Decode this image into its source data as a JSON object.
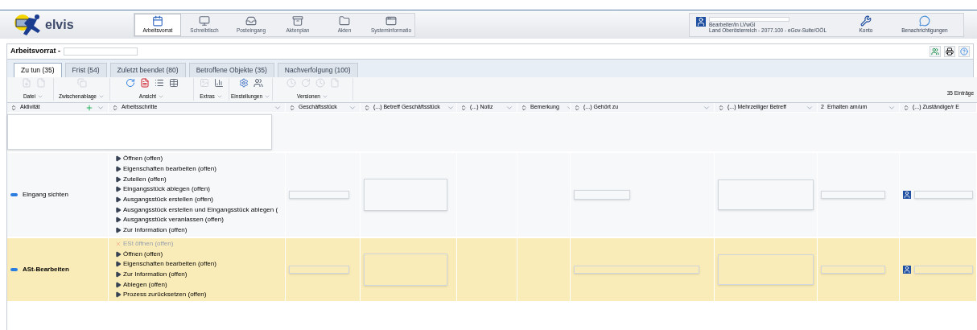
{
  "header": {
    "logo": "elvis",
    "nav": [
      {
        "label": "Arbeitsvorrat",
        "selected": true
      },
      {
        "label": "Schreibtisch",
        "selected": false
      },
      {
        "label": "Posteingang",
        "selected": false
      },
      {
        "label": "Aktenplan",
        "selected": false
      },
      {
        "label": "Akten",
        "selected": false
      },
      {
        "label": "Systeminformatio",
        "selected": false
      }
    ],
    "user": {
      "role": "Bearbeiter/in LVwGl",
      "org": "Land Oberösterreich - 2077.100 - eGov-Suite/OÖL"
    },
    "user_buttons": [
      "Konto",
      "Benachrichtigungen"
    ]
  },
  "breadcrumb": "Arbeitsvorrat -",
  "tabs": [
    {
      "label": "Zu tun (35)",
      "selected": true
    },
    {
      "label": "Frist (54)",
      "selected": false
    },
    {
      "label": "Zuletzt beendet (80)",
      "selected": false
    },
    {
      "label": "Betroffene Objekte (35)",
      "selected": false
    },
    {
      "label": "Nachverfolgung (100)",
      "selected": false
    }
  ],
  "toolbar": {
    "groups": [
      "Datei",
      "Zwischenablage",
      "Ansicht",
      "Extras",
      "Einstellungen",
      "Versionen"
    ],
    "count": "35 Einträge"
  },
  "table": {
    "columns": [
      {
        "label": "Aktivität"
      },
      {
        "label": "Arbeitsschritte"
      },
      {
        "label": "Geschäftsstück"
      },
      {
        "label": "(...) Betreff Geschäftsstück"
      },
      {
        "label": "(...) Notiz"
      },
      {
        "label": "Bemerkung"
      },
      {
        "label": "(...) Gehört zu"
      },
      {
        "label": "(...) Mehrzeiliger Betreff"
      },
      {
        "label": "Erhalten am/um",
        "sort_index": "2"
      },
      {
        "label": "(...) Zuständige/r E"
      }
    ],
    "rows": [
      {
        "activity": "Eingang sichten",
        "selected": false,
        "steps": [
          {
            "label": "Öffnen (offen)",
            "disabled": false
          },
          {
            "label": "Eigenschaften bearbeiten (offen)",
            "disabled": false
          },
          {
            "label": "Zuteilen (offen)",
            "disabled": false
          },
          {
            "label": "Eingangsstück ablegen (offen)",
            "disabled": false
          },
          {
            "label": "Ausgangsstück erstellen (offen)",
            "disabled": false
          },
          {
            "label": "Ausgangsstück erstellen und Eingangsstück ablegen (",
            "disabled": false
          },
          {
            "label": "Ausgangsstück veranlassen (offen)",
            "disabled": false
          },
          {
            "label": "Zur Information (offen)",
            "disabled": false
          }
        ]
      },
      {
        "activity": "ASt-Bearbeiten",
        "selected": true,
        "steps": [
          {
            "label": "ESt öffnen (offen)",
            "disabled": true
          },
          {
            "label": "Öffnen (offen)",
            "disabled": false
          },
          {
            "label": "Eigenschaften bearbeiten (offen)",
            "disabled": false
          },
          {
            "label": "Zur Information (offen)",
            "disabled": false
          },
          {
            "label": "Ablegen (offen)",
            "disabled": false
          },
          {
            "label": "Prozess zurücksetzen (offen)",
            "disabled": false
          }
        ]
      }
    ]
  }
}
